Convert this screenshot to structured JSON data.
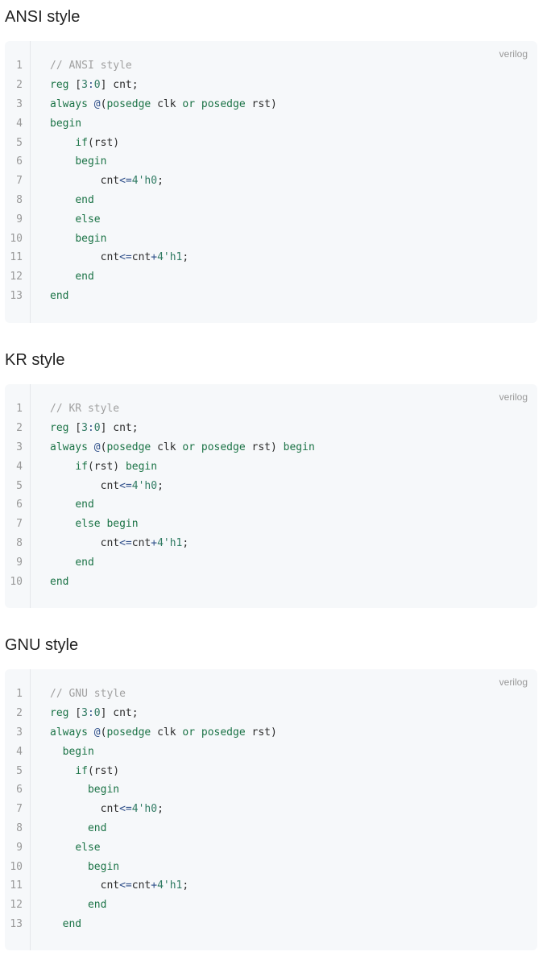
{
  "sections": [
    {
      "title": "ANSI style",
      "lang": "verilog",
      "lines": [
        {
          "no": "1",
          "tokens": [
            {
              "t": "// ANSI style",
              "k": "comment"
            }
          ]
        },
        {
          "no": "2",
          "tokens": [
            {
              "t": "reg",
              "k": "kw"
            },
            {
              "t": " [",
              "k": "id"
            },
            {
              "t": "3",
              "k": "num"
            },
            {
              "t": ":",
              "k": "op"
            },
            {
              "t": "0",
              "k": "num"
            },
            {
              "t": "] cnt;",
              "k": "id"
            }
          ]
        },
        {
          "no": "3",
          "tokens": [
            {
              "t": "always",
              "k": "kw"
            },
            {
              "t": " ",
              "k": "id"
            },
            {
              "t": "@",
              "k": "op"
            },
            {
              "t": "(",
              "k": "id"
            },
            {
              "t": "posedge",
              "k": "kw"
            },
            {
              "t": " clk ",
              "k": "id"
            },
            {
              "t": "or",
              "k": "kw"
            },
            {
              "t": " ",
              "k": "id"
            },
            {
              "t": "posedge",
              "k": "kw"
            },
            {
              "t": " rst)",
              "k": "id"
            }
          ]
        },
        {
          "no": "4",
          "tokens": [
            {
              "t": "begin",
              "k": "kw"
            }
          ]
        },
        {
          "no": "5",
          "tokens": [
            {
              "t": "    ",
              "k": "id"
            },
            {
              "t": "if",
              "k": "kw"
            },
            {
              "t": "(rst)",
              "k": "id"
            }
          ]
        },
        {
          "no": "6",
          "tokens": [
            {
              "t": "    ",
              "k": "id"
            },
            {
              "t": "begin",
              "k": "kw"
            }
          ]
        },
        {
          "no": "7",
          "tokens": [
            {
              "t": "        cnt",
              "k": "id"
            },
            {
              "t": "<=",
              "k": "op"
            },
            {
              "t": "4'h0",
              "k": "num"
            },
            {
              "t": ";",
              "k": "id"
            }
          ]
        },
        {
          "no": "8",
          "tokens": [
            {
              "t": "    ",
              "k": "id"
            },
            {
              "t": "end",
              "k": "kw"
            }
          ]
        },
        {
          "no": "9",
          "tokens": [
            {
              "t": "    ",
              "k": "id"
            },
            {
              "t": "else",
              "k": "kw"
            }
          ]
        },
        {
          "no": "10",
          "tokens": [
            {
              "t": "    ",
              "k": "id"
            },
            {
              "t": "begin",
              "k": "kw"
            }
          ]
        },
        {
          "no": "11",
          "tokens": [
            {
              "t": "        cnt",
              "k": "id"
            },
            {
              "t": "<=",
              "k": "op"
            },
            {
              "t": "cnt",
              "k": "id"
            },
            {
              "t": "+",
              "k": "op"
            },
            {
              "t": "4'h1",
              "k": "num"
            },
            {
              "t": ";",
              "k": "id"
            }
          ]
        },
        {
          "no": "12",
          "tokens": [
            {
              "t": "    ",
              "k": "id"
            },
            {
              "t": "end",
              "k": "kw"
            }
          ]
        },
        {
          "no": "13",
          "tokens": [
            {
              "t": "end",
              "k": "kw"
            }
          ]
        }
      ]
    },
    {
      "title": "KR style",
      "lang": "verilog",
      "lines": [
        {
          "no": "1",
          "tokens": [
            {
              "t": "// KR style",
              "k": "comment"
            }
          ]
        },
        {
          "no": "2",
          "tokens": [
            {
              "t": "reg",
              "k": "kw"
            },
            {
              "t": " [",
              "k": "id"
            },
            {
              "t": "3",
              "k": "num"
            },
            {
              "t": ":",
              "k": "op"
            },
            {
              "t": "0",
              "k": "num"
            },
            {
              "t": "] cnt;",
              "k": "id"
            }
          ]
        },
        {
          "no": "3",
          "tokens": [
            {
              "t": "always",
              "k": "kw"
            },
            {
              "t": " ",
              "k": "id"
            },
            {
              "t": "@",
              "k": "op"
            },
            {
              "t": "(",
              "k": "id"
            },
            {
              "t": "posedge",
              "k": "kw"
            },
            {
              "t": " clk ",
              "k": "id"
            },
            {
              "t": "or",
              "k": "kw"
            },
            {
              "t": " ",
              "k": "id"
            },
            {
              "t": "posedge",
              "k": "kw"
            },
            {
              "t": " rst) ",
              "k": "id"
            },
            {
              "t": "begin",
              "k": "kw"
            }
          ]
        },
        {
          "no": "4",
          "tokens": [
            {
              "t": "    ",
              "k": "id"
            },
            {
              "t": "if",
              "k": "kw"
            },
            {
              "t": "(rst) ",
              "k": "id"
            },
            {
              "t": "begin",
              "k": "kw"
            }
          ]
        },
        {
          "no": "5",
          "tokens": [
            {
              "t": "        cnt",
              "k": "id"
            },
            {
              "t": "<=",
              "k": "op"
            },
            {
              "t": "4'h0",
              "k": "num"
            },
            {
              "t": ";",
              "k": "id"
            }
          ]
        },
        {
          "no": "6",
          "tokens": [
            {
              "t": "    ",
              "k": "id"
            },
            {
              "t": "end",
              "k": "kw"
            }
          ]
        },
        {
          "no": "7",
          "tokens": [
            {
              "t": "    ",
              "k": "id"
            },
            {
              "t": "else",
              "k": "kw"
            },
            {
              "t": " ",
              "k": "id"
            },
            {
              "t": "begin",
              "k": "kw"
            }
          ]
        },
        {
          "no": "8",
          "tokens": [
            {
              "t": "        cnt",
              "k": "id"
            },
            {
              "t": "<=",
              "k": "op"
            },
            {
              "t": "cnt",
              "k": "id"
            },
            {
              "t": "+",
              "k": "op"
            },
            {
              "t": "4'h1",
              "k": "num"
            },
            {
              "t": ";",
              "k": "id"
            }
          ]
        },
        {
          "no": "9",
          "tokens": [
            {
              "t": "    ",
              "k": "id"
            },
            {
              "t": "end",
              "k": "kw"
            }
          ]
        },
        {
          "no": "10",
          "tokens": [
            {
              "t": "end",
              "k": "kw"
            }
          ]
        }
      ]
    },
    {
      "title": "GNU style",
      "lang": "verilog",
      "lines": [
        {
          "no": "1",
          "tokens": [
            {
              "t": "// GNU style",
              "k": "comment"
            }
          ]
        },
        {
          "no": "2",
          "tokens": [
            {
              "t": "reg",
              "k": "kw"
            },
            {
              "t": " [",
              "k": "id"
            },
            {
              "t": "3",
              "k": "num"
            },
            {
              "t": ":",
              "k": "op"
            },
            {
              "t": "0",
              "k": "num"
            },
            {
              "t": "] cnt;",
              "k": "id"
            }
          ]
        },
        {
          "no": "3",
          "tokens": [
            {
              "t": "always",
              "k": "kw"
            },
            {
              "t": " ",
              "k": "id"
            },
            {
              "t": "@",
              "k": "op"
            },
            {
              "t": "(",
              "k": "id"
            },
            {
              "t": "posedge",
              "k": "kw"
            },
            {
              "t": " clk ",
              "k": "id"
            },
            {
              "t": "or",
              "k": "kw"
            },
            {
              "t": " ",
              "k": "id"
            },
            {
              "t": "posedge",
              "k": "kw"
            },
            {
              "t": " rst)",
              "k": "id"
            }
          ]
        },
        {
          "no": "4",
          "tokens": [
            {
              "t": "  ",
              "k": "id"
            },
            {
              "t": "begin",
              "k": "kw"
            }
          ]
        },
        {
          "no": "5",
          "tokens": [
            {
              "t": "    ",
              "k": "id"
            },
            {
              "t": "if",
              "k": "kw"
            },
            {
              "t": "(rst)",
              "k": "id"
            }
          ]
        },
        {
          "no": "6",
          "tokens": [
            {
              "t": "      ",
              "k": "id"
            },
            {
              "t": "begin",
              "k": "kw"
            }
          ]
        },
        {
          "no": "7",
          "tokens": [
            {
              "t": "        cnt",
              "k": "id"
            },
            {
              "t": "<=",
              "k": "op"
            },
            {
              "t": "4'h0",
              "k": "num"
            },
            {
              "t": ";",
              "k": "id"
            }
          ]
        },
        {
          "no": "8",
          "tokens": [
            {
              "t": "      ",
              "k": "id"
            },
            {
              "t": "end",
              "k": "kw"
            }
          ]
        },
        {
          "no": "9",
          "tokens": [
            {
              "t": "    ",
              "k": "id"
            },
            {
              "t": "else",
              "k": "kw"
            }
          ]
        },
        {
          "no": "10",
          "tokens": [
            {
              "t": "      ",
              "k": "id"
            },
            {
              "t": "begin",
              "k": "kw"
            }
          ]
        },
        {
          "no": "11",
          "tokens": [
            {
              "t": "        cnt",
              "k": "id"
            },
            {
              "t": "<=",
              "k": "op"
            },
            {
              "t": "cnt",
              "k": "id"
            },
            {
              "t": "+",
              "k": "op"
            },
            {
              "t": "4'h1",
              "k": "num"
            },
            {
              "t": ";",
              "k": "id"
            }
          ]
        },
        {
          "no": "12",
          "tokens": [
            {
              "t": "      ",
              "k": "id"
            },
            {
              "t": "end",
              "k": "kw"
            }
          ]
        },
        {
          "no": "13",
          "tokens": [
            {
              "t": "  ",
              "k": "id"
            },
            {
              "t": "end",
              "k": "kw"
            }
          ]
        }
      ]
    }
  ]
}
